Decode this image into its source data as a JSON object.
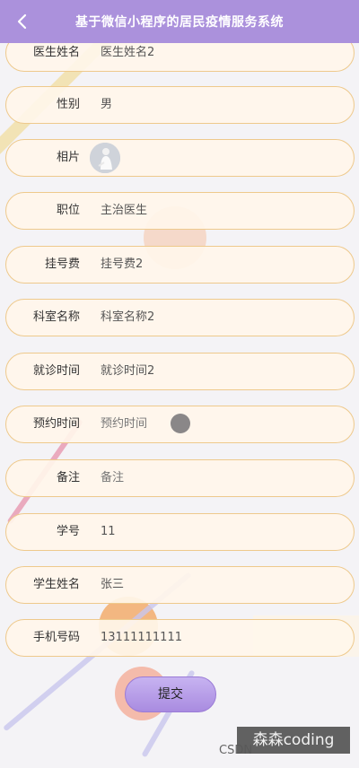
{
  "header": {
    "title": "基于微信小程序的居民疫情服务系统",
    "back_icon": "back-arrow-icon"
  },
  "form": {
    "rows": [
      {
        "label": "医生姓名",
        "value": "医生姓名2"
      },
      {
        "label": "性别",
        "value": "男"
      },
      {
        "label": "相片",
        "value": ""
      },
      {
        "label": "职位",
        "value": "主治医生"
      },
      {
        "label": "挂号费",
        "value": "挂号费2"
      },
      {
        "label": "科室名称",
        "value": "科室名称2"
      },
      {
        "label": "就诊时间",
        "value": "就诊时间2"
      },
      {
        "label": "预约时间",
        "placeholder": "预约时间"
      },
      {
        "label": "备注",
        "placeholder": "备注"
      },
      {
        "label": "学号",
        "value": "11"
      },
      {
        "label": "学生姓名",
        "value": "张三"
      },
      {
        "label": "手机号码",
        "value": "13111111111"
      }
    ]
  },
  "submit": {
    "label": "提交"
  },
  "watermark": {
    "text": "森森coding",
    "source": "CSDN"
  },
  "colors": {
    "header": "#ab91dc",
    "row_border": "#eec98c",
    "row_fill": "#fff6ea",
    "button": "#b39ae6"
  }
}
